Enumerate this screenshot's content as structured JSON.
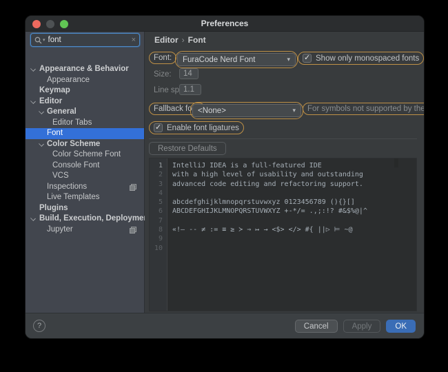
{
  "window": {
    "title": "Preferences"
  },
  "search": {
    "value": "font"
  },
  "icons": {
    "clear": "×",
    "combo_arrow": "▾",
    "check": "✓",
    "help": "?",
    "breadcrumb_sep": "›"
  },
  "colors": {
    "selection_blue": "#3370d8",
    "search_highlight_orange": "#bf9147",
    "ok_button_blue": "#3a6db6",
    "traffic_red": "#ed6a5f",
    "traffic_minimize_gray": "#4e5254",
    "traffic_green": "#61c554",
    "editor_background": "#2b2d2e"
  },
  "sidebar": {
    "items": [
      {
        "label": "Appearance & Behavior"
      },
      {
        "label": "Appearance"
      },
      {
        "label": "Keymap"
      },
      {
        "label": "Editor"
      },
      {
        "label": "General"
      },
      {
        "label": "Editor Tabs"
      },
      {
        "label": "Font"
      },
      {
        "label": "Color Scheme"
      },
      {
        "label": "Color Scheme Font"
      },
      {
        "label": "Console Font"
      },
      {
        "label": "VCS"
      },
      {
        "label": "Inspections"
      },
      {
        "label": "Live Templates"
      },
      {
        "label": "Plugins"
      },
      {
        "label": "Build, Execution, Deployment"
      },
      {
        "label": "Jupyter"
      }
    ]
  },
  "breadcrumb": {
    "first": "Editor",
    "second": "Font"
  },
  "form": {
    "font_label": "Font:",
    "font_value": "FuraCode Nerd Font",
    "monospace_checkbox_label": "Show only monospaced fonts",
    "size_label": "Size:",
    "size_value": "14",
    "line_spacing_label": "Line spacing:",
    "line_spacing_value": "1.1",
    "fallback_label": "Fallback font:",
    "fallback_value": "<None>",
    "fallback_hint": "For symbols not supported by the main for",
    "ligatures_checkbox_label": "Enable font ligatures",
    "restore_button": "Restore Defaults"
  },
  "preview": {
    "numbers": [
      "1",
      "2",
      "3",
      "4",
      "5",
      "6",
      "7",
      "8",
      "9",
      "10"
    ],
    "lines": [
      "IntelliJ IDEA is a full-featured IDE",
      "with a high level of usability and outstanding",
      "advanced code editing and refactoring support.",
      "",
      "abcdefghijklmnopqrstuvwxyz 0123456789 (){}[]",
      "ABCDEFGHIJKLMNOPQRSTUVWXYZ +-*/= .,;:!? #&$%@|^",
      "",
      "«!— -- ≠ := ≡ ≥ ≻ ⇒ ↦ → <$> </> #{ ||▷ ⊨ ~@",
      "",
      ""
    ]
  },
  "footer": {
    "help": "?",
    "cancel": "Cancel",
    "apply": "Apply",
    "ok": "OK"
  }
}
